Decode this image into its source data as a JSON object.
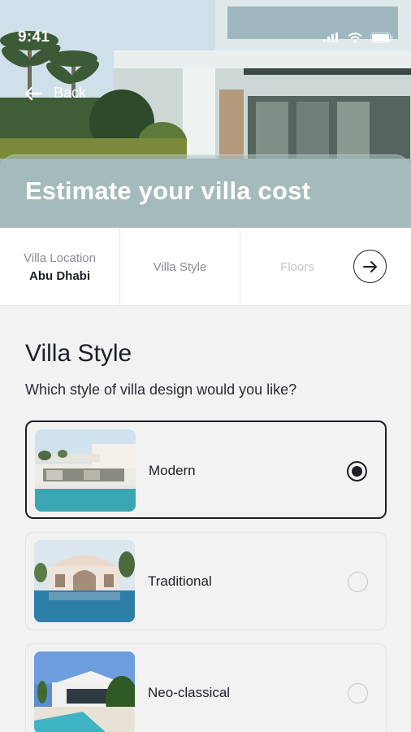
{
  "status_bar": {
    "time": "9:41"
  },
  "header": {
    "back_label": "Back",
    "title": "Estimate your villa cost"
  },
  "stepper": {
    "steps": [
      {
        "title": "Villa Location",
        "value": "Abu Dhabi"
      },
      {
        "title": "Villa Style"
      },
      {
        "title": "Floors"
      }
    ]
  },
  "section": {
    "title": "Villa Style",
    "question": "Which style of villa design would you like?",
    "options": [
      {
        "label": "Modern",
        "selected": true
      },
      {
        "label": "Traditional",
        "selected": false
      },
      {
        "label": "Neo-classical",
        "selected": false
      }
    ]
  },
  "colors": {
    "accent": "#1d1f26",
    "background": "#f2f2f3"
  },
  "icons": [
    "signal-icon",
    "wifi-icon",
    "battery-icon",
    "back-arrow-icon",
    "arrow-right-icon"
  ]
}
